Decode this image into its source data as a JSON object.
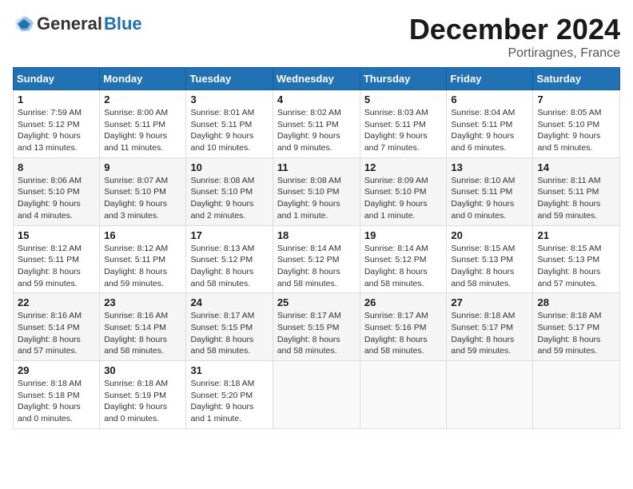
{
  "header": {
    "logo_general": "General",
    "logo_blue": "Blue",
    "month": "December 2024",
    "location": "Portiragnes, France"
  },
  "days_of_week": [
    "Sunday",
    "Monday",
    "Tuesday",
    "Wednesday",
    "Thursday",
    "Friday",
    "Saturday"
  ],
  "weeks": [
    [
      {
        "day": 1,
        "info": "Sunrise: 7:59 AM\nSunset: 5:12 PM\nDaylight: 9 hours\nand 13 minutes."
      },
      {
        "day": 2,
        "info": "Sunrise: 8:00 AM\nSunset: 5:11 PM\nDaylight: 9 hours\nand 11 minutes."
      },
      {
        "day": 3,
        "info": "Sunrise: 8:01 AM\nSunset: 5:11 PM\nDaylight: 9 hours\nand 10 minutes."
      },
      {
        "day": 4,
        "info": "Sunrise: 8:02 AM\nSunset: 5:11 PM\nDaylight: 9 hours\nand 9 minutes."
      },
      {
        "day": 5,
        "info": "Sunrise: 8:03 AM\nSunset: 5:11 PM\nDaylight: 9 hours\nand 7 minutes."
      },
      {
        "day": 6,
        "info": "Sunrise: 8:04 AM\nSunset: 5:11 PM\nDaylight: 9 hours\nand 6 minutes."
      },
      {
        "day": 7,
        "info": "Sunrise: 8:05 AM\nSunset: 5:10 PM\nDaylight: 9 hours\nand 5 minutes."
      }
    ],
    [
      {
        "day": 8,
        "info": "Sunrise: 8:06 AM\nSunset: 5:10 PM\nDaylight: 9 hours\nand 4 minutes."
      },
      {
        "day": 9,
        "info": "Sunrise: 8:07 AM\nSunset: 5:10 PM\nDaylight: 9 hours\nand 3 minutes."
      },
      {
        "day": 10,
        "info": "Sunrise: 8:08 AM\nSunset: 5:10 PM\nDaylight: 9 hours\nand 2 minutes."
      },
      {
        "day": 11,
        "info": "Sunrise: 8:08 AM\nSunset: 5:10 PM\nDaylight: 9 hours\nand 1 minute."
      },
      {
        "day": 12,
        "info": "Sunrise: 8:09 AM\nSunset: 5:10 PM\nDaylight: 9 hours\nand 1 minute."
      },
      {
        "day": 13,
        "info": "Sunrise: 8:10 AM\nSunset: 5:11 PM\nDaylight: 9 hours\nand 0 minutes."
      },
      {
        "day": 14,
        "info": "Sunrise: 8:11 AM\nSunset: 5:11 PM\nDaylight: 8 hours\nand 59 minutes."
      }
    ],
    [
      {
        "day": 15,
        "info": "Sunrise: 8:12 AM\nSunset: 5:11 PM\nDaylight: 8 hours\nand 59 minutes."
      },
      {
        "day": 16,
        "info": "Sunrise: 8:12 AM\nSunset: 5:11 PM\nDaylight: 8 hours\nand 59 minutes."
      },
      {
        "day": 17,
        "info": "Sunrise: 8:13 AM\nSunset: 5:12 PM\nDaylight: 8 hours\nand 58 minutes."
      },
      {
        "day": 18,
        "info": "Sunrise: 8:14 AM\nSunset: 5:12 PM\nDaylight: 8 hours\nand 58 minutes."
      },
      {
        "day": 19,
        "info": "Sunrise: 8:14 AM\nSunset: 5:12 PM\nDaylight: 8 hours\nand 58 minutes."
      },
      {
        "day": 20,
        "info": "Sunrise: 8:15 AM\nSunset: 5:13 PM\nDaylight: 8 hours\nand 58 minutes."
      },
      {
        "day": 21,
        "info": "Sunrise: 8:15 AM\nSunset: 5:13 PM\nDaylight: 8 hours\nand 57 minutes."
      }
    ],
    [
      {
        "day": 22,
        "info": "Sunrise: 8:16 AM\nSunset: 5:14 PM\nDaylight: 8 hours\nand 57 minutes."
      },
      {
        "day": 23,
        "info": "Sunrise: 8:16 AM\nSunset: 5:14 PM\nDaylight: 8 hours\nand 58 minutes."
      },
      {
        "day": 24,
        "info": "Sunrise: 8:17 AM\nSunset: 5:15 PM\nDaylight: 8 hours\nand 58 minutes."
      },
      {
        "day": 25,
        "info": "Sunrise: 8:17 AM\nSunset: 5:15 PM\nDaylight: 8 hours\nand 58 minutes."
      },
      {
        "day": 26,
        "info": "Sunrise: 8:17 AM\nSunset: 5:16 PM\nDaylight: 8 hours\nand 58 minutes."
      },
      {
        "day": 27,
        "info": "Sunrise: 8:18 AM\nSunset: 5:17 PM\nDaylight: 8 hours\nand 59 minutes."
      },
      {
        "day": 28,
        "info": "Sunrise: 8:18 AM\nSunset: 5:17 PM\nDaylight: 8 hours\nand 59 minutes."
      }
    ],
    [
      {
        "day": 29,
        "info": "Sunrise: 8:18 AM\nSunset: 5:18 PM\nDaylight: 9 hours\nand 0 minutes."
      },
      {
        "day": 30,
        "info": "Sunrise: 8:18 AM\nSunset: 5:19 PM\nDaylight: 9 hours\nand 0 minutes."
      },
      {
        "day": 31,
        "info": "Sunrise: 8:18 AM\nSunset: 5:20 PM\nDaylight: 9 hours\nand 1 minute."
      },
      null,
      null,
      null,
      null
    ]
  ]
}
